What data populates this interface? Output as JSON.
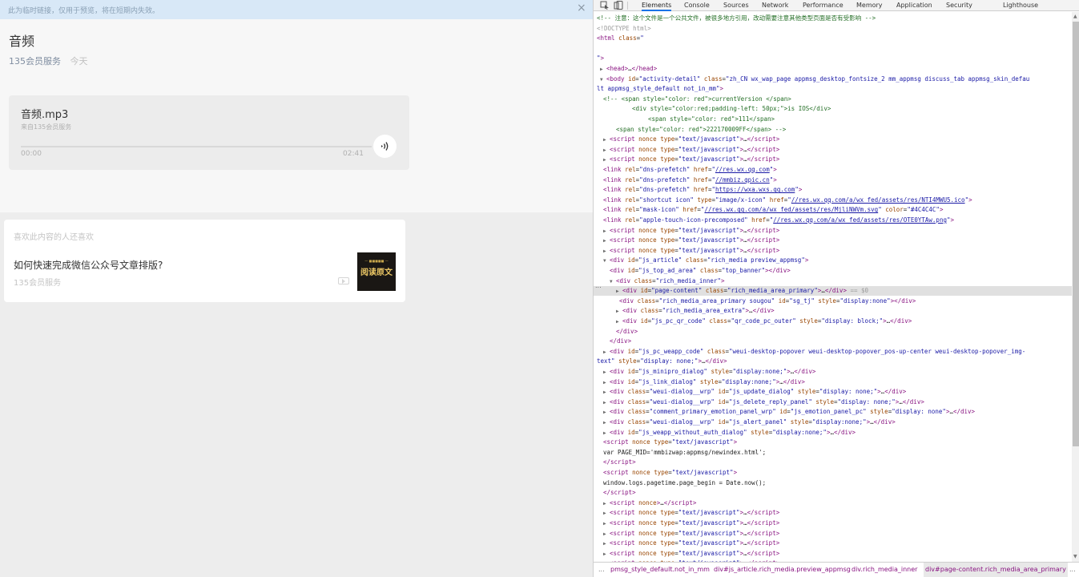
{
  "banner": {
    "text": "此为临时链接，仅用于预览，将在短期内失效。",
    "close": "×"
  },
  "article": {
    "title": "音频",
    "author": "135会员服务",
    "date": "今天"
  },
  "audio": {
    "title": "音频.mp3",
    "source": "来自135会员服务",
    "start_time": "00:00",
    "end_time": "02:41",
    "progress": 0
  },
  "related": {
    "heading": "喜欢此内容的人还喜欢",
    "item_title": "如何快速完成微信公众号文章排版?",
    "item_author": "135会员服务",
    "thumb_sub": "— ■■■■■ —",
    "thumb_main": "阅读原文"
  },
  "devtools": {
    "tabs": [
      "Elements",
      "Console",
      "Sources",
      "Network",
      "Performance",
      "Memory",
      "Application",
      "Security",
      "Lighthouse"
    ],
    "active_tab": "Elements",
    "dots": "...",
    "breadcrumbs": [
      "...",
      "pmsg_style_default.not_in_mm",
      "div#js_article.rich_media.preview_appmsg",
      "div.rich_media_inner",
      "div#page-content.rich_media_area_primary",
      "..."
    ],
    "lines": [
      {
        "i": 0,
        "tri": "",
        "html": "<span class='c'>&lt;!-- 注意：这个文件是一个公共文件，被很多地方引用，改动需要注意其他类型页面是否有受影响 --&gt;</span>"
      },
      {
        "i": 0,
        "tri": "",
        "html": "<span class='d'>&lt;!DOCTYPE html&gt;</span>"
      },
      {
        "i": 0,
        "tri": "",
        "html": "<span class='t'>&lt;html</span> <span class='a'>class</span>=<span class='v'>\"</span>"
      },
      {
        "i": 0,
        "tri": "",
        "html": ""
      },
      {
        "i": 0,
        "tri": "",
        "html": "<span class='v'>\"</span><span class='t'>&gt;</span>"
      },
      {
        "i": 1,
        "tri": "▶",
        "html": "<span class='t'>&lt;head&gt;</span>…<span class='t'>&lt;/head&gt;</span>"
      },
      {
        "i": 1,
        "tri": "▼",
        "html": "<span class='t'>&lt;body</span> <span class='a'>id</span>=<span class='v'>\"activity-detail\"</span> <span class='a'>class</span>=<span class='v'>\"zh_CN wx_wap_page appmsg_desktop_fontsize_2 mm_appmsg discuss_tab appmsg_skin_defau</span>"
      },
      {
        "i": 0,
        "tri": "",
        "html": "<span class='v'>lt appmsg_style_default not_in_mm\"</span><span class='t'>&gt;</span>"
      },
      {
        "i": 2,
        "tri": "",
        "html": "<span class='c'>&lt;!-- &lt;span style=\"color: red\"&gt;currentVersion &lt;/span&gt;</span>"
      },
      {
        "i": 11,
        "tri": "",
        "html": "<span class='c'>&lt;div style=\"color:red;padding-left: 50px;\"&gt;is IOS&lt;/div&gt;</span>"
      },
      {
        "i": 16,
        "tri": "",
        "html": "<span class='c'>&lt;span style=\"color: red\"&gt;111&lt;/span&gt;</span>"
      },
      {
        "i": 6,
        "tri": "",
        "html": "<span class='c'>&lt;span style=\"color: red\"&gt;222170009FF&lt;/span&gt; --&gt;</span>"
      },
      {
        "i": 2,
        "tri": "▶",
        "html": "<span class='t'>&lt;script</span> <span class='a'>nonce type</span>=<span class='v'>\"text/javascript\"</span><span class='t'>&gt;</span>…<span class='t'>&lt;/script&gt;</span>"
      },
      {
        "i": 2,
        "tri": "▶",
        "html": "<span class='t'>&lt;script</span> <span class='a'>nonce type</span>=<span class='v'>\"text/javascript\"</span><span class='t'>&gt;</span>…<span class='t'>&lt;/script&gt;</span>"
      },
      {
        "i": 2,
        "tri": "▶",
        "html": "<span class='t'>&lt;script</span> <span class='a'>nonce type</span>=<span class='v'>\"text/javascript\"</span><span class='t'>&gt;</span>…<span class='t'>&lt;/script&gt;</span>"
      },
      {
        "i": 2,
        "tri": "",
        "html": "<span class='t'>&lt;link</span> <span class='a'>rel</span>=<span class='v'>\"dns-prefetch\"</span> <span class='a'>href</span>=<span class='v'>\"</span><span class='u'>//res.wx.qq.com</span><span class='v'>\"</span><span class='t'>&gt;</span>"
      },
      {
        "i": 2,
        "tri": "",
        "html": "<span class='t'>&lt;link</span> <span class='a'>rel</span>=<span class='v'>\"dns-prefetch\"</span> <span class='a'>href</span>=<span class='v'>\"</span><span class='u'>//mmbiz.qpic.cn</span><span class='v'>\"</span><span class='t'>&gt;</span>"
      },
      {
        "i": 2,
        "tri": "",
        "html": "<span class='t'>&lt;link</span> <span class='a'>rel</span>=<span class='v'>\"dns-prefetch\"</span> <span class='a'>href</span>=<span class='v'>\"</span><span class='u'>https://wxa.wxs.qq.com</span><span class='v'>\"</span><span class='t'>&gt;</span>"
      },
      {
        "i": 2,
        "tri": "",
        "html": "<span class='t'>&lt;link</span> <span class='a'>rel</span>=<span class='v'>\"shortcut icon\"</span> <span class='a'>type</span>=<span class='v'>\"image/x-icon\"</span> <span class='a'>href</span>=<span class='v'>\"</span><span class='u'>//res.wx.qq.com/a/wx_fed/assets/res/NTI4MWU5.ico</span><span class='v'>\"</span><span class='t'>&gt;</span>"
      },
      {
        "i": 2,
        "tri": "",
        "html": "<span class='t'>&lt;link</span> <span class='a'>rel</span>=<span class='v'>\"mask-icon\"</span> <span class='a'>href</span>=<span class='v'>\"</span><span class='u'>//res.wx.qq.com/a/wx_fed/assets/res/MjliNWVm.svg</span><span class='v'>\"</span> <span class='a'>color</span>=<span class='v'>\"#4C4C4C\"</span><span class='t'>&gt;</span>"
      },
      {
        "i": 2,
        "tri": "",
        "html": "<span class='t'>&lt;link</span> <span class='a'>rel</span>=<span class='v'>\"apple-touch-icon-precomposed\"</span> <span class='a'>href</span>=<span class='v'>\"</span><span class='u'>//res.wx.qq.com/a/wx_fed/assets/res/OTE0YTAw.png</span><span class='v'>\"</span><span class='t'>&gt;</span>"
      },
      {
        "i": 2,
        "tri": "▶",
        "html": "<span class='t'>&lt;script</span> <span class='a'>nonce type</span>=<span class='v'>\"text/javascript\"</span><span class='t'>&gt;</span>…<span class='t'>&lt;/script&gt;</span>"
      },
      {
        "i": 2,
        "tri": "▶",
        "html": "<span class='t'>&lt;script</span> <span class='a'>nonce type</span>=<span class='v'>\"text/javascript\"</span><span class='t'>&gt;</span>…<span class='t'>&lt;/script&gt;</span>"
      },
      {
        "i": 2,
        "tri": "▶",
        "html": "<span class='t'>&lt;script</span> <span class='a'>nonce type</span>=<span class='v'>\"text/javascript\"</span><span class='t'>&gt;</span>…<span class='t'>&lt;/script&gt;</span>"
      },
      {
        "i": 2,
        "tri": "▼",
        "html": "<span class='t'>&lt;div</span> <span class='a'>id</span>=<span class='v'>\"js_article\"</span> <span class='a'>class</span>=<span class='v'>\"rich_media preview_appmsg\"</span><span class='t'>&gt;</span>"
      },
      {
        "i": 4,
        "tri": "",
        "html": "<span class='t'>&lt;div</span> <span class='a'>id</span>=<span class='v'>\"js_top_ad_area\"</span> <span class='a'>class</span>=<span class='v'>\"top_banner\"</span><span class='t'>&gt;&lt;/div&gt;</span>"
      },
      {
        "i": 4,
        "tri": "▼",
        "html": "<span class='t'>&lt;div</span> <span class='a'>class</span>=<span class='v'>\"rich_media_inner\"</span><span class='t'>&gt;</span>"
      },
      {
        "i": 6,
        "tri": "▶",
        "sel": true,
        "html": "<span class='t'>&lt;div</span> <span class='a'>id</span>=<span class='v'>\"page-content\"</span> <span class='a'>class</span>=<span class='v'>\"rich_media_area_primary\"</span><span class='t'>&gt;</span>…<span class='t'>&lt;/div&gt;</span> <span class='d'>== $0</span>"
      },
      {
        "i": 7,
        "tri": "",
        "html": "<span class='t'>&lt;div</span> <span class='a'>class</span>=<span class='v'>\"rich_media_area_primary sougou\"</span> <span class='a'>id</span>=<span class='v'>\"sg_tj\"</span> <span class='a'>style</span>=<span class='v'>\"display:none\"</span><span class='t'>&gt;&lt;/div&gt;</span>"
      },
      {
        "i": 6,
        "tri": "▶",
        "html": "<span class='t'>&lt;div</span> <span class='a'>class</span>=<span class='v'>\"rich_media_area_extra\"</span><span class='t'>&gt;</span>…<span class='t'>&lt;/div&gt;</span>"
      },
      {
        "i": 6,
        "tri": "▶",
        "html": "<span class='t'>&lt;div</span> <span class='a'>id</span>=<span class='v'>\"js_pc_qr_code\"</span> <span class='a'>class</span>=<span class='v'>\"qr_code_pc_outer\"</span> <span class='a'>style</span>=<span class='v'>\"display: block;\"</span><span class='t'>&gt;</span>…<span class='t'>&lt;/div&gt;</span>"
      },
      {
        "i": 6,
        "tri": "",
        "html": "<span class='t'>&lt;/div&gt;</span>"
      },
      {
        "i": 4,
        "tri": "",
        "html": "<span class='t'>&lt;/div&gt;</span>"
      },
      {
        "i": 2,
        "tri": "▶",
        "html": "<span class='t'>&lt;div</span> <span class='a'>id</span>=<span class='v'>\"js_pc_weapp_code\"</span> <span class='a'>class</span>=<span class='v'>\"weui-desktop-popover weui-desktop-popover_pos-up-center weui-desktop-popover_img-</span>"
      },
      {
        "i": 0,
        "tri": "",
        "html": "<span class='v'>text\"</span> <span class='a'>style</span>=<span class='v'>\"display: none;\"</span><span class='t'>&gt;</span>…<span class='t'>&lt;/div&gt;</span>"
      },
      {
        "i": 2,
        "tri": "▶",
        "html": "<span class='t'>&lt;div</span> <span class='a'>id</span>=<span class='v'>\"js_minipro_dialog\"</span> <span class='a'>style</span>=<span class='v'>\"display:none;\"</span><span class='t'>&gt;</span>…<span class='t'>&lt;/div&gt;</span>"
      },
      {
        "i": 2,
        "tri": "▶",
        "html": "<span class='t'>&lt;div</span> <span class='a'>id</span>=<span class='v'>\"js_link_dialog\"</span> <span class='a'>style</span>=<span class='v'>\"display:none;\"</span><span class='t'>&gt;</span>…<span class='t'>&lt;/div&gt;</span>"
      },
      {
        "i": 2,
        "tri": "▶",
        "html": "<span class='t'>&lt;div</span> <span class='a'>class</span>=<span class='v'>\"weui-dialog__wrp\"</span> <span class='a'>id</span>=<span class='v'>\"js_update_dialog\"</span> <span class='a'>style</span>=<span class='v'>\"display: none;\"</span><span class='t'>&gt;</span>…<span class='t'>&lt;/div&gt;</span>"
      },
      {
        "i": 2,
        "tri": "▶",
        "html": "<span class='t'>&lt;div</span> <span class='a'>class</span>=<span class='v'>\"weui-dialog__wrp\"</span> <span class='a'>id</span>=<span class='v'>\"js_delete_reply_panel\"</span> <span class='a'>style</span>=<span class='v'>\"display: none;\"</span><span class='t'>&gt;</span>…<span class='t'>&lt;/div&gt;</span>"
      },
      {
        "i": 2,
        "tri": "▶",
        "html": "<span class='t'>&lt;div</span> <span class='a'>class</span>=<span class='v'>\"comment_primary_emotion_panel_wrp\"</span> <span class='a'>id</span>=<span class='v'>\"js_emotion_panel_pc\"</span> <span class='a'>style</span>=<span class='v'>\"display: none\"</span><span class='t'>&gt;</span>…<span class='t'>&lt;/div&gt;</span>"
      },
      {
        "i": 2,
        "tri": "▶",
        "html": "<span class='t'>&lt;div</span> <span class='a'>class</span>=<span class='v'>\"weui-dialog__wrp\"</span> <span class='a'>id</span>=<span class='v'>\"js_alert_panel\"</span> <span class='a'>style</span>=<span class='v'>\"display:none;\"</span><span class='t'>&gt;</span>…<span class='t'>&lt;/div&gt;</span>"
      },
      {
        "i": 2,
        "tri": "▶",
        "html": "<span class='t'>&lt;div</span> <span class='a'>id</span>=<span class='v'>\"js_weapp_without_auth_dialog\"</span> <span class='a'>style</span>=<span class='v'>\"display:none;\"</span><span class='t'>&gt;</span>…<span class='t'>&lt;/div&gt;</span>"
      },
      {
        "i": 2,
        "tri": "",
        "html": "<span class='t'>&lt;script</span> <span class='a'>nonce type</span>=<span class='v'>\"text/javascript\"</span><span class='t'>&gt;</span>"
      },
      {
        "i": 2,
        "tri": "",
        "html": "var PAGE_MID='mmbizwap:appmsg/newindex.html';"
      },
      {
        "i": 2,
        "tri": "",
        "html": "<span class='t'>&lt;/script&gt;</span>"
      },
      {
        "i": 2,
        "tri": "",
        "html": "<span class='t'>&lt;script</span> <span class='a'>nonce type</span>=<span class='v'>\"text/javascript\"</span><span class='t'>&gt;</span>"
      },
      {
        "i": 2,
        "tri": "",
        "html": "window.logs.pagetime.page_begin = Date.now();"
      },
      {
        "i": 2,
        "tri": "",
        "html": "<span class='t'>&lt;/script&gt;</span>"
      },
      {
        "i": 2,
        "tri": "▶",
        "html": "<span class='t'>&lt;script</span> <span class='a'>nonce</span><span class='t'>&gt;</span>…<span class='t'>&lt;/script&gt;</span>"
      },
      {
        "i": 2,
        "tri": "▶",
        "html": "<span class='t'>&lt;script</span> <span class='a'>nonce type</span>=<span class='v'>\"text/javascript\"</span><span class='t'>&gt;</span>…<span class='t'>&lt;/script&gt;</span>"
      },
      {
        "i": 2,
        "tri": "▶",
        "html": "<span class='t'>&lt;script</span> <span class='a'>nonce type</span>=<span class='v'>\"text/javascript\"</span><span class='t'>&gt;</span>…<span class='t'>&lt;/script&gt;</span>"
      },
      {
        "i": 2,
        "tri": "▶",
        "html": "<span class='t'>&lt;script</span> <span class='a'>nonce type</span>=<span class='v'>\"text/javascript\"</span><span class='t'>&gt;</span>…<span class='t'>&lt;/script&gt;</span>"
      },
      {
        "i": 2,
        "tri": "▶",
        "html": "<span class='t'>&lt;script</span> <span class='a'>nonce type</span>=<span class='v'>\"text/javascript\"</span><span class='t'>&gt;</span>…<span class='t'>&lt;/script&gt;</span>"
      },
      {
        "i": 2,
        "tri": "▶",
        "html": "<span class='t'>&lt;script</span> <span class='a'>nonce type</span>=<span class='v'>\"text/javascript\"</span><span class='t'>&gt;</span>…<span class='t'>&lt;/script&gt;</span>"
      },
      {
        "i": 2,
        "tri": "▶",
        "html": "<span class='t'>&lt;script</span> <span class='a'>nonce type</span>=<span class='v'>\"text/javascript\"</span><span class='t'>&gt;</span>…<span class='t'>&lt;/script&gt;</span>"
      }
    ]
  },
  "colors": {
    "accent": "#1a73e8",
    "banner": "#d8e8f7",
    "tag": "#881280",
    "attr": "#994500",
    "value": "#1a1aa6",
    "comment": "#236e25"
  },
  "icons": {
    "inspect": "inspect-element-icon",
    "device": "device-toolbar-icon",
    "play": "audio-play-icon",
    "video": "video-icon",
    "close": "close-icon"
  }
}
